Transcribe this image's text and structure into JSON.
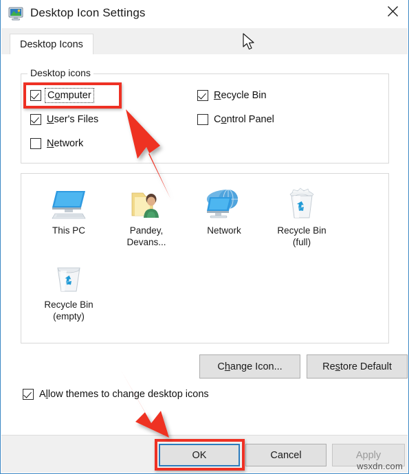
{
  "window": {
    "title": "Desktop Icon Settings",
    "title_icon": "monitor-settings-icon",
    "close_label": "✕"
  },
  "tabs": [
    {
      "label": "Desktop Icons",
      "active": true
    }
  ],
  "desktop_icons_group": {
    "legend": "Desktop icons",
    "checkboxes": [
      {
        "name": "computer",
        "label_pre": "C",
        "accel": "o",
        "label_post": "mputer",
        "checked": true,
        "focused": true,
        "column": "left"
      },
      {
        "name": "users-files",
        "label_pre": "",
        "accel": "U",
        "label_post": "ser's Files",
        "checked": true,
        "focused": false,
        "column": "left"
      },
      {
        "name": "network",
        "label_pre": "",
        "accel": "N",
        "label_post": "etwork",
        "checked": false,
        "focused": false,
        "column": "left"
      },
      {
        "name": "recycle-bin",
        "label_pre": "",
        "accel": "R",
        "label_post": "ecycle Bin",
        "checked": true,
        "focused": false,
        "column": "right"
      },
      {
        "name": "control-panel",
        "label_pre": "C",
        "accel": "o",
        "label_post": "ntrol Panel",
        "checked": false,
        "focused": false,
        "column": "right"
      }
    ]
  },
  "icon_preview": {
    "items": [
      {
        "name": "this-pc",
        "icon": "monitor-icon",
        "line1": "This PC",
        "line2": ""
      },
      {
        "name": "user-folder",
        "icon": "user-folder-icon",
        "line1": "Pandey,",
        "line2": "Devans..."
      },
      {
        "name": "network",
        "icon": "network-globe-icon",
        "line1": "Network",
        "line2": ""
      },
      {
        "name": "recycle-bin-full",
        "icon": "recycle-bin-full-icon",
        "line1": "Recycle Bin",
        "line2": "(full)"
      },
      {
        "name": "recycle-bin-empty",
        "icon": "recycle-bin-empty-icon",
        "line1": "Recycle Bin",
        "line2": "(empty)"
      }
    ]
  },
  "icon_buttons": {
    "change_icon": {
      "pre": "C",
      "accel": "h",
      "post": "ange Icon..."
    },
    "restore_default": {
      "pre": "Re",
      "accel": "s",
      "post": "tore Default"
    }
  },
  "allow_themes": {
    "label_pre": "A",
    "accel": "l",
    "label_post": "low themes to change desktop icons",
    "checked": true
  },
  "footer": {
    "ok": "OK",
    "cancel": "Cancel",
    "apply": "Apply",
    "apply_disabled": true,
    "watermark": "wsxdn.com"
  },
  "annotations": {
    "highlight_color": "#ee3124",
    "focus_color": "#2b7bbd",
    "boxes": [
      {
        "name": "computer-checkbox-highlight"
      },
      {
        "name": "ok-button-highlight"
      }
    ],
    "arrows": [
      {
        "name": "arrow-to-computer-checkbox",
        "direction": "up-left"
      },
      {
        "name": "arrow-to-ok-button",
        "direction": "down-right"
      }
    ]
  },
  "cursor": {
    "type": "arrow-pointer"
  }
}
